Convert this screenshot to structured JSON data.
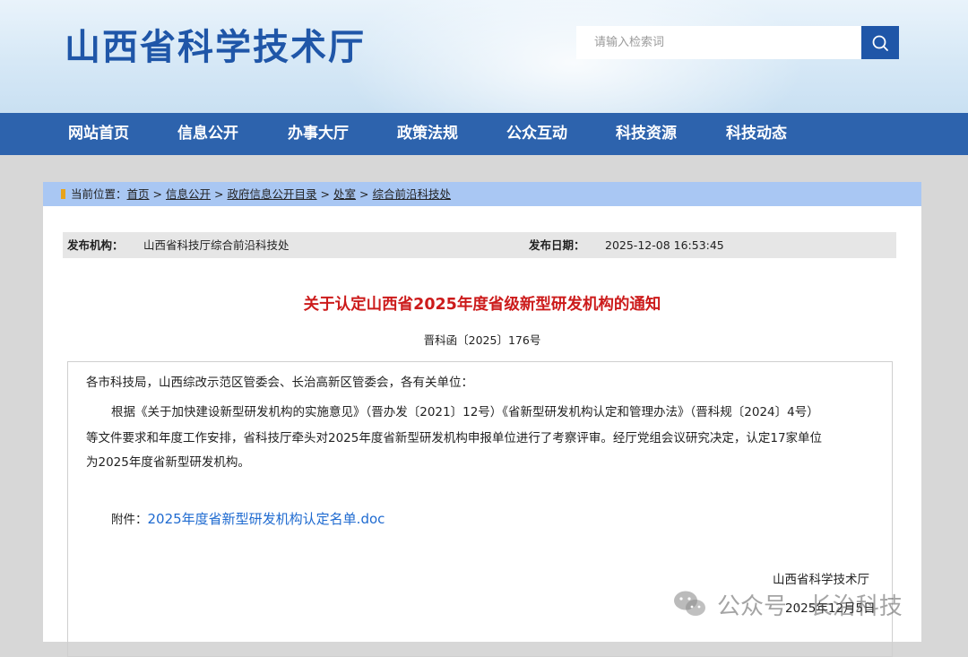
{
  "header": {
    "site_title": "山西省科学技术厅",
    "search_placeholder": "请输入检索词",
    "search_icon": "search-icon"
  },
  "nav": {
    "items": [
      "网站首页",
      "信息公开",
      "办事大厅",
      "政策法规",
      "公众互动",
      "科技资源",
      "科技动态"
    ]
  },
  "breadcrumb": {
    "prefix": "当前位置：",
    "items": [
      "首页",
      "信息公开",
      "政府信息公开目录",
      "处室",
      "综合前沿科技处"
    ],
    "separator": ">"
  },
  "meta": {
    "publisher_label": "发布机构：",
    "publisher_value": "山西省科技厅综合前沿科技处",
    "date_label": "发布日期：",
    "date_value": "2025-12-08 16:53:45"
  },
  "article": {
    "title": "关于认定山西省2025年度省级新型研发机构的通知",
    "doc_number": "晋科函〔2025〕176号",
    "salutation": "各市科技局，山西综改示范区管委会、长治高新区管委会，各有关单位：",
    "para_line1": "根据《关于加快建设新型研发机构的实施意见》（晋办发〔2021〕12号）《省新型研发机构认定和管理办法》（晋科规〔2024〕4号）",
    "para_line2": "等文件要求和年度工作安排，省科技厅牵头对2025年度省新型研发机构申报单位进行了考察评审。经厅党组会议研究决定，认定17家单位",
    "para_line3": "为2025年度省新型研发机构。",
    "attachment_label": "附件：",
    "attachment_link": "2025年度省新型研发机构认定名单.doc",
    "signature_org": "山西省科学技术厅",
    "signature_date": "2025年12月5日"
  },
  "watermark": {
    "text": "公众号 · 长治科技",
    "icon": "wechat-icon"
  },
  "colors": {
    "brand_blue": "#2d63ad",
    "title_red": "#cc1b1b",
    "breadcrumb_bg": "#a9c7f3",
    "link_blue": "#1e6ad0"
  }
}
